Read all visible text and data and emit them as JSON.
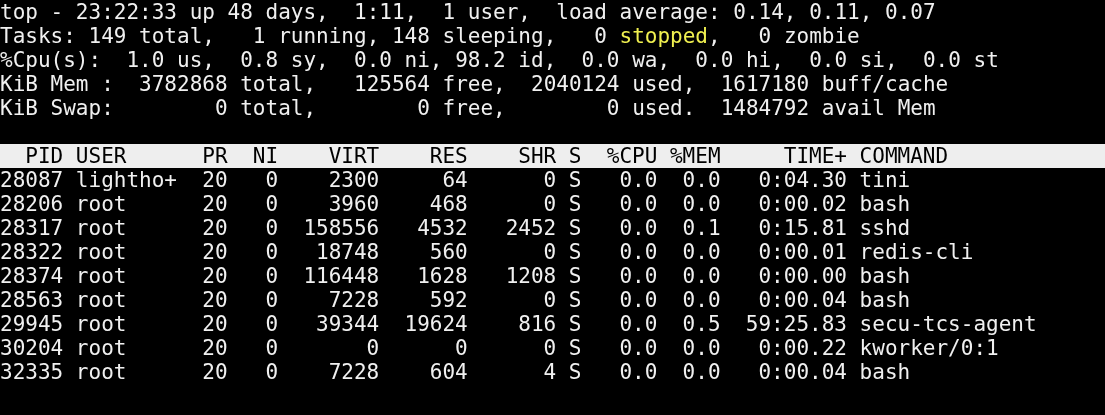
{
  "summary": [
    [
      {
        "text": "top - 23:22:33 up 48 days,  1:11,  1 user,  load average: 0.14, 0.11, 0.07",
        "highlighted": false
      }
    ],
    [
      {
        "text": "Tasks: 149 total,   1 running, 148 sleeping,   0 ",
        "highlighted": false
      },
      {
        "text": "stopped",
        "highlighted": true
      },
      {
        "text": ",   0 zombie",
        "highlighted": false
      }
    ],
    [
      {
        "text": "%Cpu(s):  1.0 us,  0.8 sy,  0.0 ni, 98.2 id,  0.0 wa,  0.0 hi,  0.0 si,  0.0 st",
        "highlighted": false
      }
    ],
    [
      {
        "text": "KiB Mem :  3782868 total,   125564 free,  2040124 used,  1617180 buff/cache",
        "highlighted": false
      }
    ],
    [
      {
        "text": "KiB Swap:        0 total,        0 free,        0 used.  1484792 avail Mem",
        "highlighted": false
      }
    ]
  ],
  "table": {
    "columns": [
      "PID",
      "USER",
      "PR",
      "NI",
      "VIRT",
      "RES",
      "SHR",
      "S",
      "%CPU",
      "%MEM",
      "TIME+",
      "COMMAND"
    ],
    "rows": [
      [
        "28087",
        "lightho+",
        "20",
        "0",
        "2300",
        "64",
        "0",
        "S",
        "0.0",
        "0.0",
        "0:04.30",
        "tini"
      ],
      [
        "28206",
        "root",
        "20",
        "0",
        "3960",
        "468",
        "0",
        "S",
        "0.0",
        "0.0",
        "0:00.02",
        "bash"
      ],
      [
        "28317",
        "root",
        "20",
        "0",
        "158556",
        "4532",
        "2452",
        "S",
        "0.0",
        "0.1",
        "0:15.81",
        "sshd"
      ],
      [
        "28322",
        "root",
        "20",
        "0",
        "18748",
        "560",
        "0",
        "S",
        "0.0",
        "0.0",
        "0:00.01",
        "redis-cli"
      ],
      [
        "28374",
        "root",
        "20",
        "0",
        "116448",
        "1628",
        "1208",
        "S",
        "0.0",
        "0.0",
        "0:00.00",
        "bash"
      ],
      [
        "28563",
        "root",
        "20",
        "0",
        "7228",
        "592",
        "0",
        "S",
        "0.0",
        "0.0",
        "0:00.04",
        "bash"
      ],
      [
        "29945",
        "root",
        "20",
        "0",
        "39344",
        "19624",
        "816",
        "S",
        "0.0",
        "0.5",
        "59:25.83",
        "secu-tcs-agent"
      ],
      [
        "30204",
        "root",
        "20",
        "0",
        "0",
        "0",
        "0",
        "S",
        "0.0",
        "0.0",
        "0:00.22",
        "kworker/0:1"
      ],
      [
        "32335",
        "root",
        "20",
        "0",
        "7228",
        "604",
        "4",
        "S",
        "0.0",
        "0.0",
        "0:00.04",
        "bash"
      ]
    ]
  }
}
